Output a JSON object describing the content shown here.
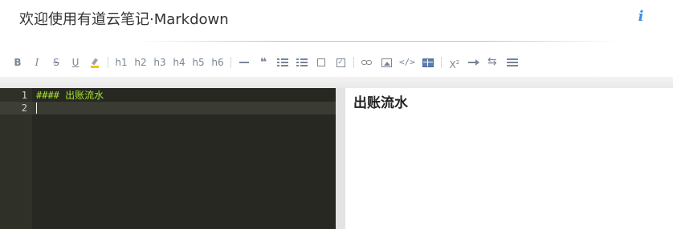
{
  "app": {
    "document_title": "欢迎使用有道云笔记·Markdown",
    "info_icon": "info-icon"
  },
  "toolbar": {
    "format": [
      {
        "name": "bold",
        "label": "B"
      },
      {
        "name": "italic",
        "label": "I"
      },
      {
        "name": "strikethrough",
        "label": "S"
      },
      {
        "name": "underline",
        "label": "U"
      },
      {
        "name": "highlight",
        "icon": "highlighter-icon"
      }
    ],
    "headings": [
      "h1",
      "h2",
      "h3",
      "h4",
      "h5",
      "h6"
    ],
    "blocks": [
      {
        "name": "horizontal-rule",
        "icon": "hr-icon"
      },
      {
        "name": "quote",
        "icon": "quote-icon",
        "glyph": "❝"
      },
      {
        "name": "unordered-list",
        "icon": "list-ul-icon"
      },
      {
        "name": "ordered-list",
        "icon": "list-ol-icon"
      },
      {
        "name": "checkbox",
        "icon": "checkbox-icon"
      },
      {
        "name": "checked-checkbox",
        "icon": "checkbox-checked-icon",
        "glyph": "✓"
      }
    ],
    "insert": [
      {
        "name": "link",
        "icon": "link-icon"
      },
      {
        "name": "image",
        "icon": "image-icon"
      },
      {
        "name": "code",
        "icon": "code-icon",
        "glyph": "</>"
      },
      {
        "name": "table",
        "icon": "table-icon"
      }
    ],
    "misc": [
      {
        "name": "superscript",
        "icon": "superscript-icon",
        "glyph": "X",
        "sup": "2"
      },
      {
        "name": "arrow",
        "icon": "arrow-right-icon"
      },
      {
        "name": "swap",
        "icon": "swap-icon"
      },
      {
        "name": "lines",
        "icon": "lines-icon"
      }
    ]
  },
  "editor": {
    "line_numbers": [
      "1",
      "2"
    ],
    "lines": [
      "#### 出账流水",
      ""
    ]
  },
  "preview": {
    "heading": "出账流水"
  },
  "colors": {
    "editor_bg": "#272822",
    "markdown_text": "#a6e22e",
    "info_accent": "#3a8ee6"
  }
}
